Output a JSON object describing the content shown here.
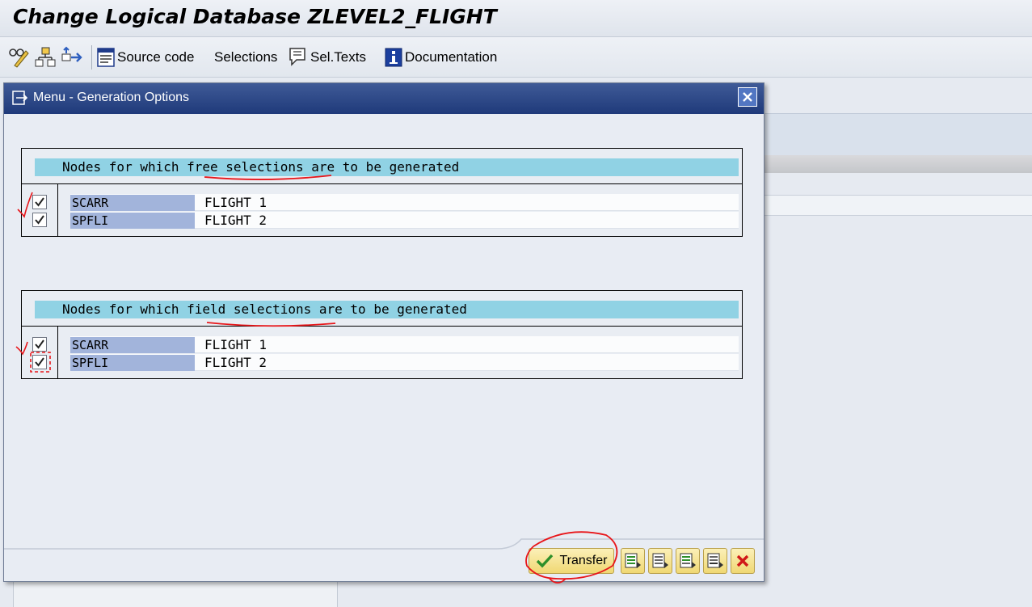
{
  "window": {
    "title": "Change Logical Database ZLEVEL2_FLIGHT"
  },
  "toolbar": {
    "source_code": "Source code",
    "selections": "Selections",
    "sel_texts": "Sel.Texts",
    "documentation": "Documentation"
  },
  "dialog": {
    "title": "Menu - Generation Options",
    "free_group": {
      "header": "Nodes for which free selections are to be generated",
      "rows": [
        {
          "node": "SCARR",
          "text": "FLIGHT 1",
          "checked": true
        },
        {
          "node": "SPFLI",
          "text": "FLIGHT 2",
          "checked": true
        }
      ]
    },
    "field_group": {
      "header": "Nodes for which field selections are to be generated",
      "rows": [
        {
          "node": "SCARR",
          "text": "FLIGHT 1",
          "checked": true
        },
        {
          "node": "SPFLI",
          "text": "FLIGHT 2",
          "checked": true
        }
      ]
    },
    "buttons": {
      "transfer": "Transfer"
    }
  },
  "colors": {
    "dialog_title_bg": "#2a4786",
    "group_header_bg": "#90d2e4",
    "node_cell_bg": "#a2b4db",
    "button_bg": "#f5e08e",
    "annotation_red": "#e8161a"
  }
}
